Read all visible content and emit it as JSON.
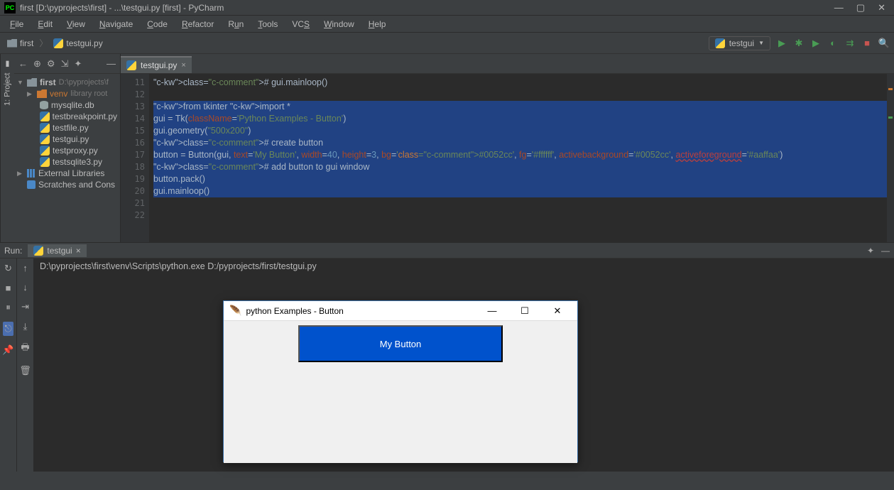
{
  "titlebar": {
    "app_icon": "PC",
    "title": "first [D:\\pyprojects\\first] - ...\\testgui.py [first] - PyCharm"
  },
  "menu": [
    "File",
    "Edit",
    "View",
    "Navigate",
    "Code",
    "Refactor",
    "Run",
    "Tools",
    "VCS",
    "Window",
    "Help"
  ],
  "breadcrumbs": {
    "project": "first",
    "file": "testgui.py"
  },
  "run_config": {
    "name": "testgui"
  },
  "project_tree": {
    "root": "first",
    "root_path": "D:\\pyprojects\\f",
    "venv": "venv",
    "venv_note": "library root",
    "files": [
      "mysqlite.db",
      "testbreakpoint.py",
      "testfile.py",
      "testgui.py",
      "testproxy.py",
      "testsqlite3.py"
    ],
    "ext_libs": "External Libraries",
    "scratches": "Scratches and Cons"
  },
  "sidebar_vertical": "1: Project",
  "editor": {
    "tab": "testgui.py",
    "line_start": 11,
    "lines": [
      "# gui.mainloop()",
      "",
      "from tkinter import *",
      "gui = Tk(className='Python Examples - Button')",
      "gui.geometry(\"500x200\")",
      "# create button",
      "button = Button(gui, text='My Button', width=40, height=3, bg='#0052cc', fg='#ffffff', activebackground='#0052cc', activeforeground='#aaffaa')",
      "# add button to gui window",
      "button.pack()",
      "gui.mainloop()",
      "",
      ""
    ],
    "selected_from": 13,
    "selected_to": 20
  },
  "run_panel": {
    "label": "Run:",
    "tab": "testgui",
    "command": "D:\\pyprojects\\first\\venv\\Scripts\\python.exe D:/pyprojects/first/testgui.py"
  },
  "tk_window": {
    "title": "python Examples - Button",
    "button_text": "My Button",
    "bg": "#0052cc",
    "fg": "#ffffff"
  }
}
